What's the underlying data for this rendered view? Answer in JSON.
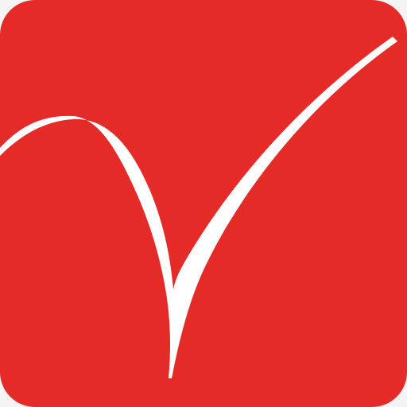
{
  "app_icon": {
    "icon_name": "checkmark-v-logo-icon",
    "colors": {
      "background": "#e42b28",
      "mark": "#ffffff",
      "page": "#f4f4f4"
    }
  }
}
